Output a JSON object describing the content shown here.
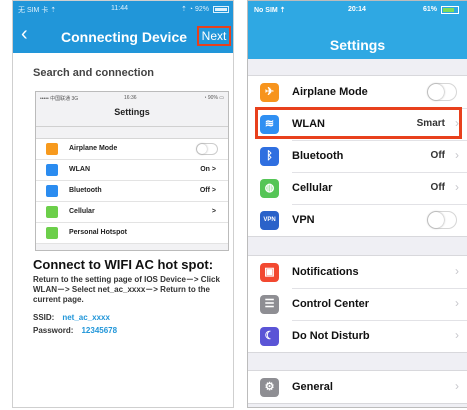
{
  "left": {
    "status": {
      "carrier": "无 SIM 卡 ⇡",
      "time": "11:44",
      "right": "⇡ ◔ 92%"
    },
    "header": {
      "back_icon": "chevron-left-icon",
      "title": "Connecting Device",
      "next_label": "Next"
    },
    "section_title": "Search and connection",
    "embedded": {
      "status": {
        "left": "••••• 中国联通 3G",
        "time": "16:36",
        "right": "◔ 90% ▭"
      },
      "title": "Settings",
      "rows": [
        {
          "label": "Airplane Mode",
          "value": "",
          "toggle": true,
          "color": "#f79a1e"
        },
        {
          "label": "WLAN",
          "value": "On >",
          "toggle": false,
          "color": "#2b8cf0"
        },
        {
          "label": "Bluetooth",
          "value": "Off >",
          "toggle": false,
          "color": "#2b8cf0"
        },
        {
          "label": "Cellular",
          "value": ">",
          "toggle": false,
          "color": "#6ccf4a"
        },
        {
          "label": "Personal Hotspot",
          "value": "",
          "toggle": false,
          "color": "#6ccf4a"
        }
      ]
    },
    "heading": "Connect to WIFI AC hot spot:",
    "description": "Return to the setting page of IOS Device－> Click WLAN－> Select net_ac_xxxx－> Return to the current page.",
    "ssid_label": "SSID:",
    "ssid_value": "net_ac_xxxx",
    "password_label": "Password:",
    "password_value": "12345678"
  },
  "right": {
    "status": {
      "carrier": "No SIM ⇡",
      "time": "20:14",
      "battery": "61%"
    },
    "title": "Settings",
    "groups": [
      [
        {
          "label": "Airplane Mode",
          "value": "",
          "toggle": true,
          "icon": "airplane-icon",
          "glyph": "✈",
          "color": "#f7941d"
        },
        {
          "label": "WLAN",
          "value": "Smart",
          "toggle": false,
          "icon": "wifi-icon",
          "glyph": "≋",
          "color": "#2f8ff2"
        },
        {
          "label": "Bluetooth",
          "value": "Off",
          "toggle": false,
          "icon": "bluetooth-icon",
          "glyph": "ᛒ",
          "color": "#2f6fe0"
        },
        {
          "label": "Cellular",
          "value": "Off",
          "toggle": false,
          "icon": "cellular-icon",
          "glyph": "◍",
          "color": "#55c556"
        },
        {
          "label": "VPN",
          "value": "",
          "toggle": true,
          "icon": "vpn-icon",
          "glyph": "VPN",
          "color": "#2a62c9"
        }
      ],
      [
        {
          "label": "Notifications",
          "value": "",
          "toggle": false,
          "icon": "notifications-icon",
          "glyph": "▣",
          "color": "#f24830"
        },
        {
          "label": "Control Center",
          "value": "",
          "toggle": false,
          "icon": "control-center-icon",
          "glyph": "☰",
          "color": "#8e8e93"
        },
        {
          "label": "Do Not Disturb",
          "value": "",
          "toggle": false,
          "icon": "moon-icon",
          "glyph": "☾",
          "color": "#5a54d6"
        }
      ],
      [
        {
          "label": "General",
          "value": "",
          "toggle": false,
          "icon": "gear-icon",
          "glyph": "⚙",
          "color": "#8e8e93"
        }
      ]
    ]
  }
}
